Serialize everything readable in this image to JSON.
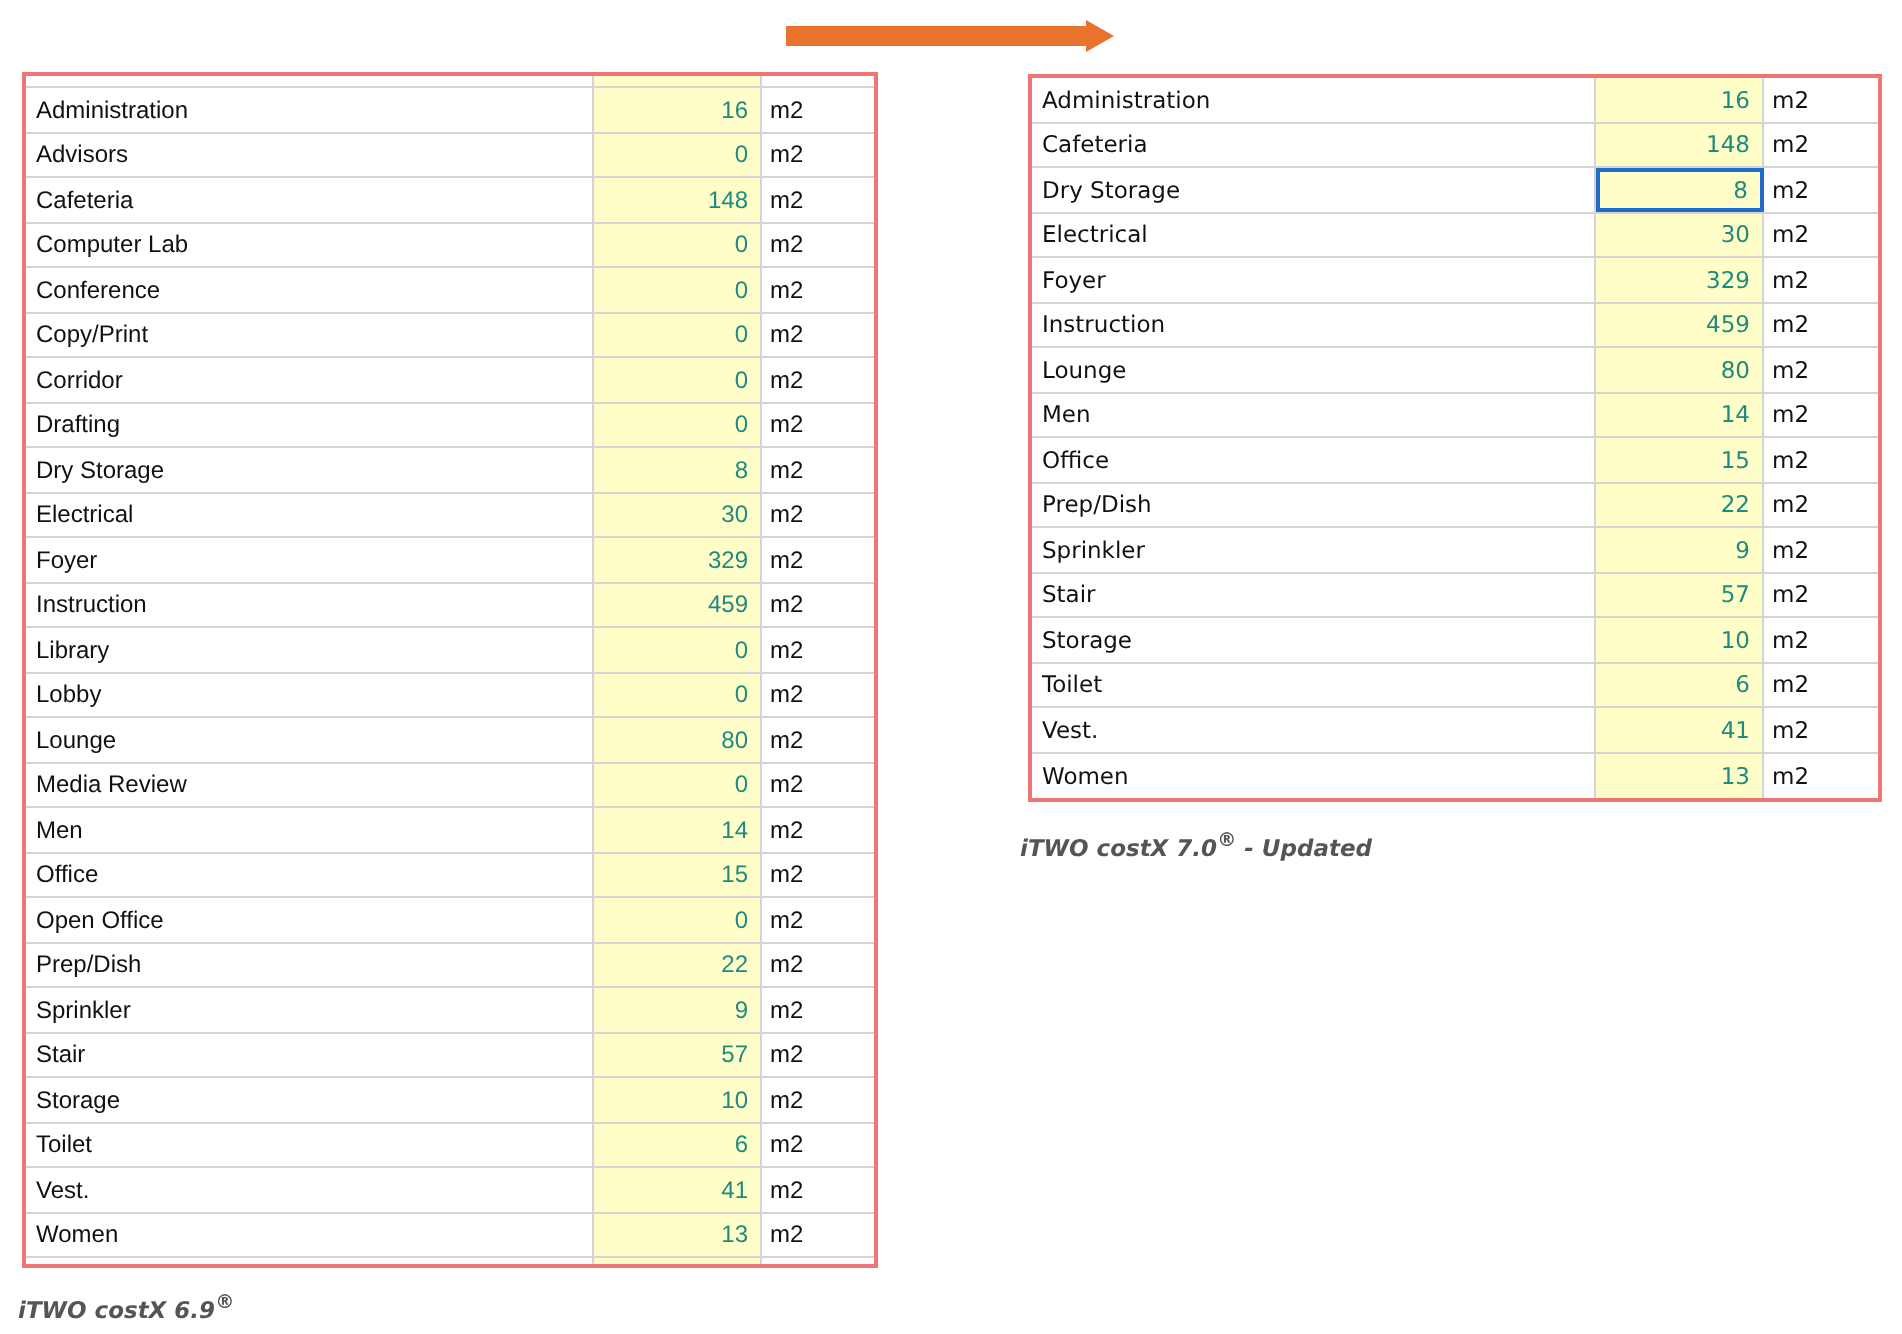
{
  "panels": [
    {
      "kind": "legacy",
      "rows": [
        {
          "name": "Administration",
          "value": "16",
          "unit": "m2"
        },
        {
          "name": "Advisors",
          "value": "0",
          "unit": "m2"
        },
        {
          "name": "Cafeteria",
          "value": "148",
          "unit": "m2"
        },
        {
          "name": "Computer Lab",
          "value": "0",
          "unit": "m2"
        },
        {
          "name": "Conference",
          "value": "0",
          "unit": "m2"
        },
        {
          "name": "Copy/Print",
          "value": "0",
          "unit": "m2"
        },
        {
          "name": "Corridor",
          "value": "0",
          "unit": "m2"
        },
        {
          "name": "Drafting",
          "value": "0",
          "unit": "m2"
        },
        {
          "name": "Dry Storage",
          "value": "8",
          "unit": "m2"
        },
        {
          "name": "Electrical",
          "value": "30",
          "unit": "m2"
        },
        {
          "name": "Foyer",
          "value": "329",
          "unit": "m2"
        },
        {
          "name": "Instruction",
          "value": "459",
          "unit": "m2"
        },
        {
          "name": "Library",
          "value": "0",
          "unit": "m2"
        },
        {
          "name": "Lobby",
          "value": "0",
          "unit": "m2"
        },
        {
          "name": "Lounge",
          "value": "80",
          "unit": "m2"
        },
        {
          "name": "Media Review",
          "value": "0",
          "unit": "m2"
        },
        {
          "name": "Men",
          "value": "14",
          "unit": "m2"
        },
        {
          "name": "Office",
          "value": "15",
          "unit": "m2"
        },
        {
          "name": "Open Office",
          "value": "0",
          "unit": "m2"
        },
        {
          "name": "Prep/Dish",
          "value": "22",
          "unit": "m2"
        },
        {
          "name": "Sprinkler",
          "value": "9",
          "unit": "m2"
        },
        {
          "name": "Stair",
          "value": "57",
          "unit": "m2"
        },
        {
          "name": "Storage",
          "value": "10",
          "unit": "m2"
        },
        {
          "name": "Toilet",
          "value": "6",
          "unit": "m2"
        },
        {
          "name": "Vest.",
          "value": "41",
          "unit": "m2"
        },
        {
          "name": "Women",
          "value": "13",
          "unit": "m2"
        }
      ],
      "caption": "iTWO costX 6.9$^{®}$"
    },
    {
      "kind": "updated",
      "rows": [
        {
          "name": "Administration",
          "value": "16",
          "unit": "m2",
          "selected": false
        },
        {
          "name": "Cafeteria",
          "value": "148",
          "unit": "m2",
          "selected": false
        },
        {
          "name": "Dry Storage",
          "value": "8",
          "unit": "m2",
          "selected": true
        },
        {
          "name": "Electrical",
          "value": "30",
          "unit": "m2",
          "selected": false
        },
        {
          "name": "Foyer",
          "value": "329",
          "unit": "m2",
          "selected": false
        },
        {
          "name": "Instruction",
          "value": "459",
          "unit": "m2",
          "selected": false
        },
        {
          "name": "Lounge",
          "value": "80",
          "unit": "m2",
          "selected": false
        },
        {
          "name": "Men",
          "value": "14",
          "unit": "m2",
          "selected": false
        },
        {
          "name": "Office",
          "value": "15",
          "unit": "m2",
          "selected": false
        },
        {
          "name": "Prep/Dish",
          "value": "22",
          "unit": "m2",
          "selected": false
        },
        {
          "name": "Sprinkler",
          "value": "9",
          "unit": "m2",
          "selected": false
        },
        {
          "name": "Stair",
          "value": "57",
          "unit": "m2",
          "selected": false
        },
        {
          "name": "Storage",
          "value": "10",
          "unit": "m2",
          "selected": false
        },
        {
          "name": "Toilet",
          "value": "6",
          "unit": "m2",
          "selected": false
        },
        {
          "name": "Vest.",
          "value": "41",
          "unit": "m2",
          "selected": false
        },
        {
          "name": "Women",
          "value": "13",
          "unit": "m2",
          "selected": false
        }
      ],
      "caption": "iTWO costX 7.0$^{®}$ - Updated"
    }
  ]
}
